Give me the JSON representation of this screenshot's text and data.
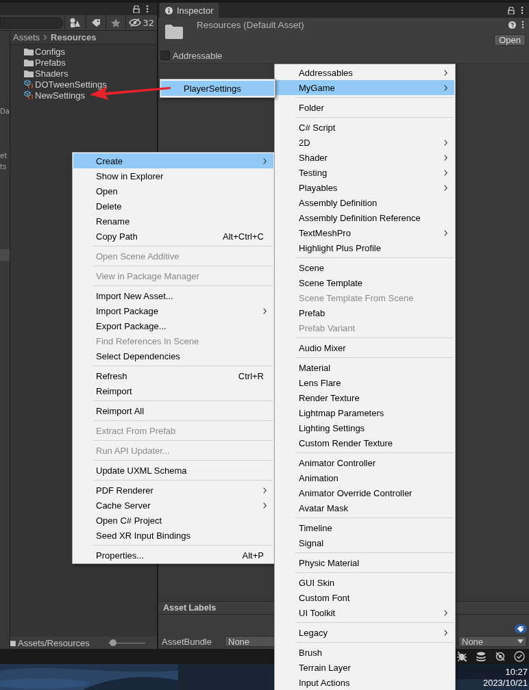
{
  "project_panel": {
    "hidden_count": "32",
    "sidebar_fragments": [
      "Da",
      "et",
      "ts"
    ],
    "breadcrumb": [
      "Assets",
      "Resources"
    ],
    "items": [
      {
        "kind": "folder",
        "name": "Configs"
      },
      {
        "kind": "folder",
        "name": "Prefabs"
      },
      {
        "kind": "folder",
        "name": "Shaders"
      },
      {
        "kind": "script_asset",
        "name": "DOTweenSettings"
      },
      {
        "kind": "script_asset",
        "name": "NewSettings"
      }
    ],
    "footer_path": "Assets/Resources",
    "zoom": {
      "level": 0.05
    }
  },
  "inspector": {
    "tab": "Inspector",
    "title": "Resources (Default Asset)",
    "open_button": "Open",
    "addressable": {
      "label": "Addressable",
      "checked": false
    },
    "asset_labels": "Asset Labels",
    "asset_bundle": {
      "label": "AssetBundle",
      "value": "None",
      "variant": "None"
    }
  },
  "context_menu": {
    "items": [
      {
        "kind": "item",
        "label": "Create",
        "submenu": true,
        "disabled": false,
        "selected": true
      },
      {
        "kind": "item",
        "label": "Show in Explorer",
        "submenu": false,
        "disabled": false,
        "selected": false
      },
      {
        "kind": "item",
        "label": "Open",
        "submenu": false,
        "disabled": false,
        "selected": false
      },
      {
        "kind": "item",
        "label": "Delete",
        "submenu": false,
        "disabled": false,
        "selected": false
      },
      {
        "kind": "item",
        "label": "Rename",
        "submenu": false,
        "disabled": false,
        "selected": false
      },
      {
        "kind": "item",
        "label": "Copy Path",
        "shortcut": "Alt+Ctrl+C",
        "submenu": false,
        "disabled": false,
        "selected": false
      },
      {
        "kind": "separator"
      },
      {
        "kind": "item",
        "label": "Open Scene Additive",
        "submenu": false,
        "disabled": true,
        "selected": false
      },
      {
        "kind": "separator"
      },
      {
        "kind": "item",
        "label": "View in Package Manager",
        "submenu": false,
        "disabled": true,
        "selected": false
      },
      {
        "kind": "separator"
      },
      {
        "kind": "item",
        "label": "Import New Asset...",
        "submenu": false,
        "disabled": false,
        "selected": false
      },
      {
        "kind": "item",
        "label": "Import Package",
        "submenu": true,
        "disabled": false,
        "selected": false
      },
      {
        "kind": "item",
        "label": "Export Package...",
        "submenu": false,
        "disabled": false,
        "selected": false
      },
      {
        "kind": "item",
        "label": "Find References In Scene",
        "submenu": false,
        "disabled": true,
        "selected": false
      },
      {
        "kind": "item",
        "label": "Select Dependencies",
        "submenu": false,
        "disabled": false,
        "selected": false
      },
      {
        "kind": "separator"
      },
      {
        "kind": "item",
        "label": "Refresh",
        "shortcut": "Ctrl+R",
        "submenu": false,
        "disabled": false,
        "selected": false
      },
      {
        "kind": "item",
        "label": "Reimport",
        "submenu": false,
        "disabled": false,
        "selected": false
      },
      {
        "kind": "separator"
      },
      {
        "kind": "item",
        "label": "Reimport All",
        "submenu": false,
        "disabled": false,
        "selected": false
      },
      {
        "kind": "separator"
      },
      {
        "kind": "item",
        "label": "Extract From Prefab",
        "submenu": false,
        "disabled": true,
        "selected": false
      },
      {
        "kind": "separator"
      },
      {
        "kind": "item",
        "label": "Run API Updater...",
        "submenu": false,
        "disabled": true,
        "selected": false
      },
      {
        "kind": "separator"
      },
      {
        "kind": "item",
        "label": "Update UXML Schema",
        "submenu": false,
        "disabled": false,
        "selected": false
      },
      {
        "kind": "separator"
      },
      {
        "kind": "item",
        "label": "PDF Renderer",
        "submenu": true,
        "disabled": false,
        "selected": false
      },
      {
        "kind": "item",
        "label": "Cache Server",
        "submenu": true,
        "disabled": false,
        "selected": false
      },
      {
        "kind": "item",
        "label": "Open C# Project",
        "submenu": false,
        "disabled": false,
        "selected": false
      },
      {
        "kind": "item",
        "label": "Seed XR Input Bindings",
        "submenu": false,
        "disabled": false,
        "selected": false
      },
      {
        "kind": "separator"
      },
      {
        "kind": "item",
        "label": "Properties...",
        "shortcut": "Alt+P",
        "submenu": false,
        "disabled": false,
        "selected": false
      }
    ]
  },
  "create_menu": {
    "items": [
      {
        "kind": "item",
        "label": "Addressables",
        "submenu": true,
        "disabled": false,
        "selected": false
      },
      {
        "kind": "item",
        "label": "MyGame",
        "submenu": true,
        "disabled": false,
        "selected": true
      },
      {
        "kind": "separator"
      },
      {
        "kind": "item",
        "label": "Folder",
        "submenu": false,
        "disabled": false,
        "selected": false
      },
      {
        "kind": "separator"
      },
      {
        "kind": "item",
        "label": "C# Script",
        "submenu": false,
        "disabled": false,
        "selected": false
      },
      {
        "kind": "item",
        "label": "2D",
        "submenu": true,
        "disabled": false,
        "selected": false
      },
      {
        "kind": "item",
        "label": "Shader",
        "submenu": true,
        "disabled": false,
        "selected": false
      },
      {
        "kind": "item",
        "label": "Testing",
        "submenu": true,
        "disabled": false,
        "selected": false
      },
      {
        "kind": "item",
        "label": "Playables",
        "submenu": true,
        "disabled": false,
        "selected": false
      },
      {
        "kind": "item",
        "label": "Assembly Definition",
        "submenu": false,
        "disabled": false,
        "selected": false
      },
      {
        "kind": "item",
        "label": "Assembly Definition Reference",
        "submenu": false,
        "disabled": false,
        "selected": false
      },
      {
        "kind": "item",
        "label": "TextMeshPro",
        "submenu": true,
        "disabled": false,
        "selected": false
      },
      {
        "kind": "item",
        "label": "Highlight Plus Profile",
        "submenu": false,
        "disabled": false,
        "selected": false
      },
      {
        "kind": "separator"
      },
      {
        "kind": "item",
        "label": "Scene",
        "submenu": false,
        "disabled": false,
        "selected": false
      },
      {
        "kind": "item",
        "label": "Scene Template",
        "submenu": false,
        "disabled": false,
        "selected": false
      },
      {
        "kind": "item",
        "label": "Scene Template From Scene",
        "submenu": false,
        "disabled": true,
        "selected": false
      },
      {
        "kind": "item",
        "label": "Prefab",
        "submenu": false,
        "disabled": false,
        "selected": false
      },
      {
        "kind": "item",
        "label": "Prefab Variant",
        "submenu": false,
        "disabled": true,
        "selected": false
      },
      {
        "kind": "separator"
      },
      {
        "kind": "item",
        "label": "Audio Mixer",
        "submenu": false,
        "disabled": false,
        "selected": false
      },
      {
        "kind": "separator"
      },
      {
        "kind": "item",
        "label": "Material",
        "submenu": false,
        "disabled": false,
        "selected": false
      },
      {
        "kind": "item",
        "label": "Lens Flare",
        "submenu": false,
        "disabled": false,
        "selected": false
      },
      {
        "kind": "item",
        "label": "Render Texture",
        "submenu": false,
        "disabled": false,
        "selected": false
      },
      {
        "kind": "item",
        "label": "Lightmap Parameters",
        "submenu": false,
        "disabled": false,
        "selected": false
      },
      {
        "kind": "item",
        "label": "Lighting Settings",
        "submenu": false,
        "disabled": false,
        "selected": false
      },
      {
        "kind": "item",
        "label": "Custom Render Texture",
        "submenu": false,
        "disabled": false,
        "selected": false
      },
      {
        "kind": "separator"
      },
      {
        "kind": "item",
        "label": "Animator Controller",
        "submenu": false,
        "disabled": false,
        "selected": false
      },
      {
        "kind": "item",
        "label": "Animation",
        "submenu": false,
        "disabled": false,
        "selected": false
      },
      {
        "kind": "item",
        "label": "Animator Override Controller",
        "submenu": false,
        "disabled": false,
        "selected": false
      },
      {
        "kind": "item",
        "label": "Avatar Mask",
        "submenu": false,
        "disabled": false,
        "selected": false
      },
      {
        "kind": "separator"
      },
      {
        "kind": "item",
        "label": "Timeline",
        "submenu": false,
        "disabled": false,
        "selected": false
      },
      {
        "kind": "item",
        "label": "Signal",
        "submenu": false,
        "disabled": false,
        "selected": false
      },
      {
        "kind": "separator"
      },
      {
        "kind": "item",
        "label": "Physic Material",
        "submenu": false,
        "disabled": false,
        "selected": false
      },
      {
        "kind": "separator"
      },
      {
        "kind": "item",
        "label": "GUI Skin",
        "submenu": false,
        "disabled": false,
        "selected": false
      },
      {
        "kind": "item",
        "label": "Custom Font",
        "submenu": false,
        "disabled": false,
        "selected": false
      },
      {
        "kind": "item",
        "label": "UI Toolkit",
        "submenu": true,
        "disabled": false,
        "selected": false
      },
      {
        "kind": "separator"
      },
      {
        "kind": "item",
        "label": "Legacy",
        "submenu": true,
        "disabled": false,
        "selected": false
      },
      {
        "kind": "separator"
      },
      {
        "kind": "item",
        "label": "Brush",
        "submenu": false,
        "disabled": false,
        "selected": false
      },
      {
        "kind": "item",
        "label": "Terrain Layer",
        "submenu": false,
        "disabled": false,
        "selected": false
      },
      {
        "kind": "item",
        "label": "Input Actions",
        "submenu": false,
        "disabled": false,
        "selected": false
      }
    ]
  },
  "mygame_menu": {
    "items": [
      {
        "kind": "item",
        "label": "PlayerSettings",
        "submenu": false,
        "disabled": false,
        "selected": true
      }
    ]
  },
  "taskbar": {
    "time": "10:27",
    "date": "2023/10/21"
  }
}
